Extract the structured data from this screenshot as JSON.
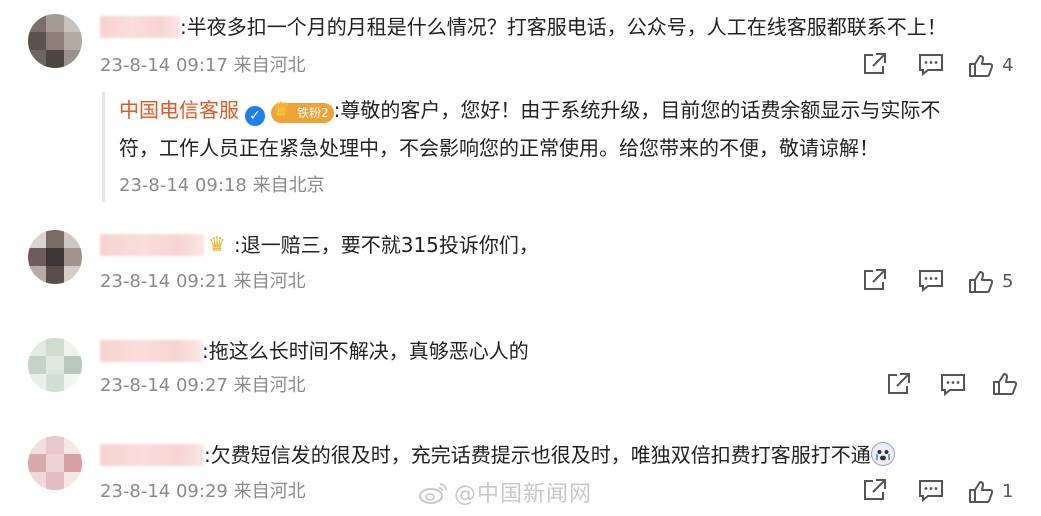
{
  "comments": [
    {
      "text": ":半夜多扣一个月的月租是什么情况？打客服电话，公众号，人工在线客服都联系不上！",
      "time": "23-8-14 09:17",
      "location": "来自河北",
      "likes": "4",
      "reply": {
        "name": "中国电信客服",
        "badge": "铁粉2",
        "text_line1": ":尊敬的客户，您好！由于系统升级，目前您的话费余额显示与实际不",
        "text_line2": "符，工作人员正在紧急处理中，不会影响您的正常使用。给您带来的不便，敬请谅解！",
        "time": "23-8-14 09:18",
        "location": "来自北京"
      }
    },
    {
      "text": ":退一赔三，要不就315投诉你们，",
      "time": "23-8-14 09:21",
      "location": "来自河北",
      "likes": "5"
    },
    {
      "text": ":拖这么长时间不解决，真够恶心人的",
      "time": "23-8-14 09:27",
      "location": "来自河北",
      "likes": ""
    },
    {
      "text": ":欠费短信发的很及时，充完话费提示也很及时，唯独双倍扣费打客服打不通",
      "time": "23-8-14 09:29",
      "location": "来自河北",
      "likes": "1"
    }
  ],
  "watermark": "@中国新闻网",
  "icons": [
    "share-icon",
    "comment-icon",
    "like-icon",
    "verified-icon",
    "crown-icon",
    "weibo-logo-icon",
    "crying-emoji-icon"
  ],
  "colors": {
    "reply_name": "#e8571d",
    "verified": "#1d7ff0",
    "text": "#222222",
    "meta": "#8a8a8a"
  }
}
